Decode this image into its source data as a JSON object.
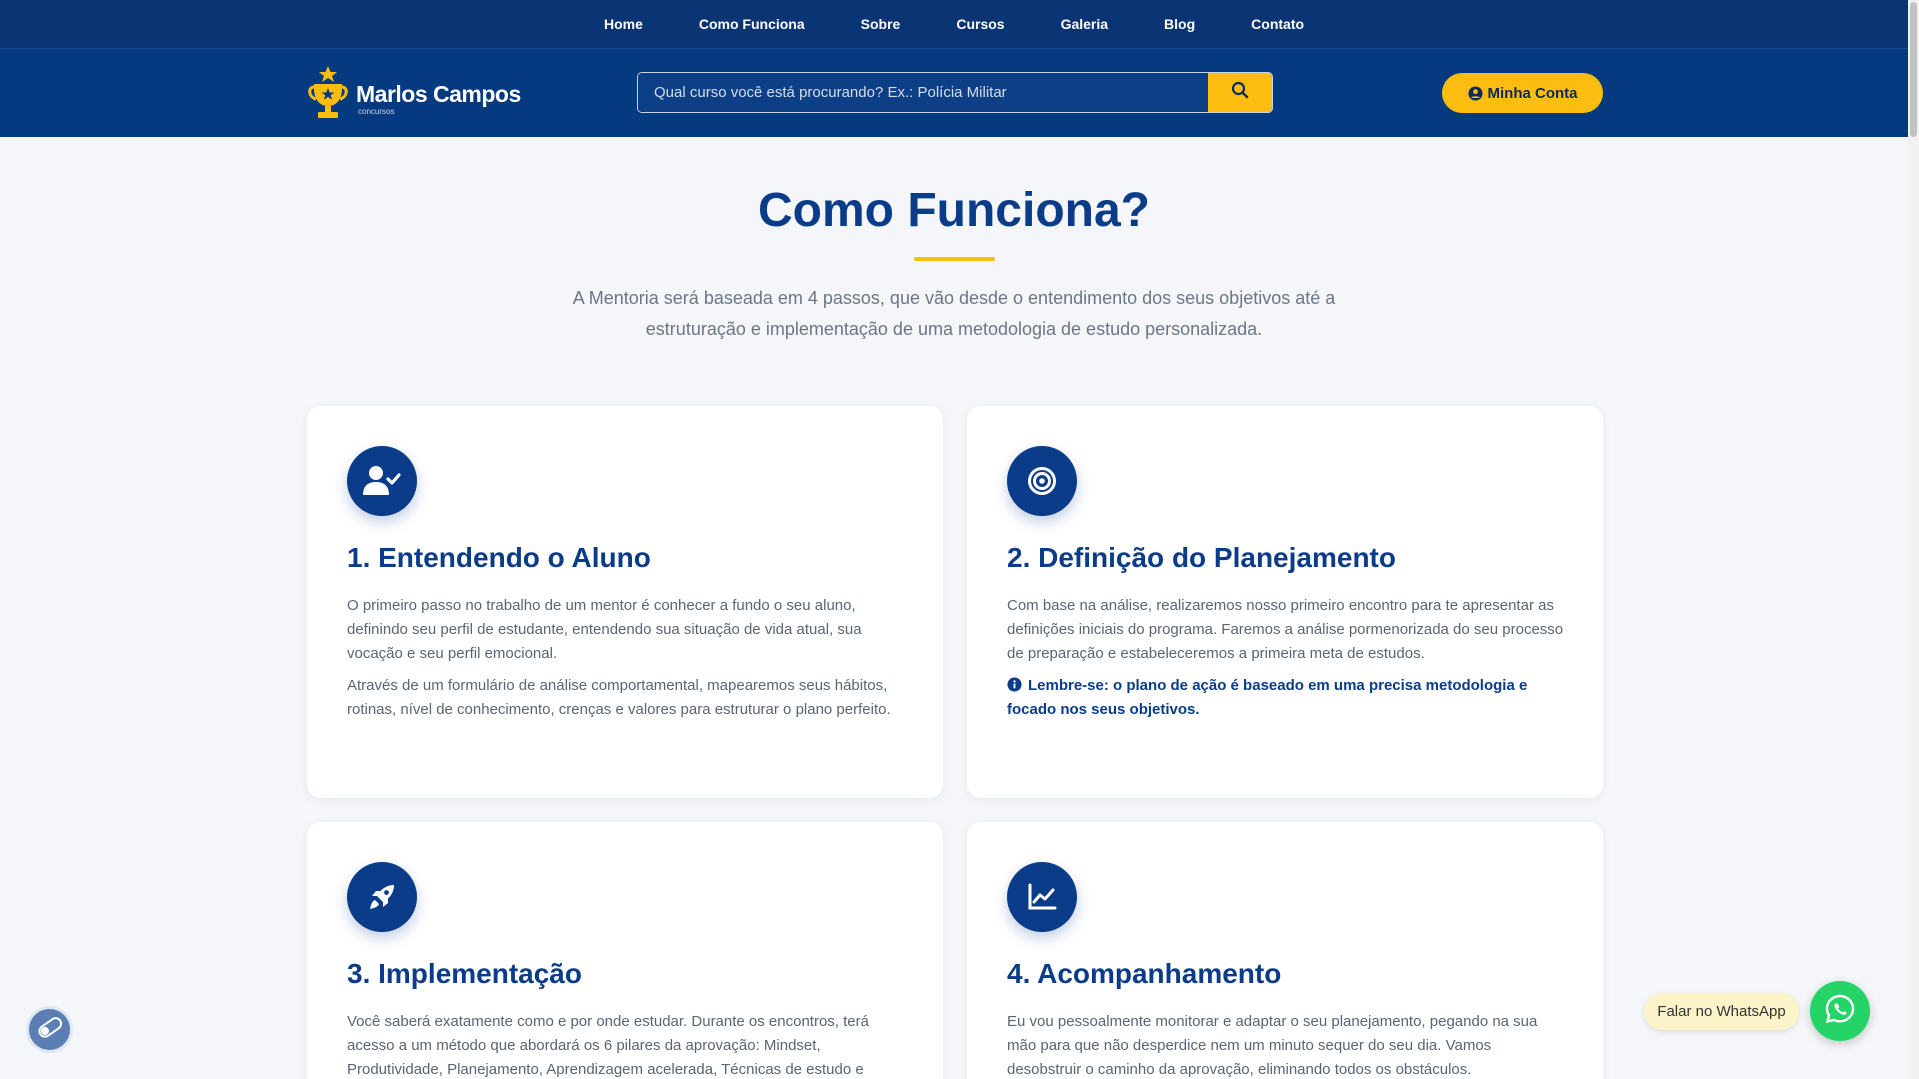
{
  "nav": {
    "items": [
      {
        "label": "Home"
      },
      {
        "label": "Como Funciona"
      },
      {
        "label": "Sobre"
      },
      {
        "label": "Cursos"
      },
      {
        "label": "Galeria"
      },
      {
        "label": "Blog"
      },
      {
        "label": "Contato"
      }
    ]
  },
  "header": {
    "logo_name": "Marlos Campos",
    "logo_sub": "concursos",
    "search_placeholder": "Qual curso você está procurando? Ex.: Polícia Militar",
    "account_label": "Minha Conta"
  },
  "section": {
    "title": "Como Funciona?",
    "description": "A Mentoria será baseada em 4 passos, que vão desde o entendimento dos seus objetivos até a estruturação e implementação de uma metodologia de estudo personalizada."
  },
  "cards": [
    {
      "icon": "user-check-icon",
      "title": "1. Entendendo o Aluno",
      "p1": "O primeiro passo no trabalho de um mentor é conhecer a fundo o seu aluno, definindo seu perfil de estudante, entendendo sua situação de vida atual, sua vocação e seu perfil emocional.",
      "p2": "Através de um formulário de análise comportamental, mapearemos seus hábitos, rotinas, nível de conhecimento, crenças e valores para estruturar o plano perfeito."
    },
    {
      "icon": "target-icon",
      "title": "2. Definição do Planejamento",
      "p1": "Com base na análise, realizaremos nosso primeiro encontro para te apresentar as definições iniciais do programa. Faremos a análise pormenorizada do seu processo de preparação e estabeleceremos a primeira meta de estudos.",
      "note": "Lembre-se: o plano de ação é baseado em uma precisa metodologia e focado nos seus objetivos."
    },
    {
      "icon": "rocket-icon",
      "title": "3. Implementação",
      "p1": "Você saberá exatamente como e por onde estudar. Durante os encontros, terá acesso a um método que abordará os 6 pilares da aprovação: Mindset, Produtividade, Planejamento, Aprendizagem acelerada, Técnicas de estudo e"
    },
    {
      "icon": "chart-line-icon",
      "title": "4. Acompanhamento",
      "p1": "Eu vou pessoalmente monitorar e adaptar o seu planejamento, pegando na sua mão para que não desperdice nem um minuto sequer do seu dia. Vamos desobstruir o caminho da aprovação, eliminando todos os obstáculos."
    }
  ],
  "floating": {
    "whatsapp_label": "Falar no WhatsApp"
  },
  "colors": {
    "primary": "#0a3c8a",
    "nav_bg": "#0a3473",
    "accent": "#fdbd10",
    "whatsapp": "#25d366"
  }
}
